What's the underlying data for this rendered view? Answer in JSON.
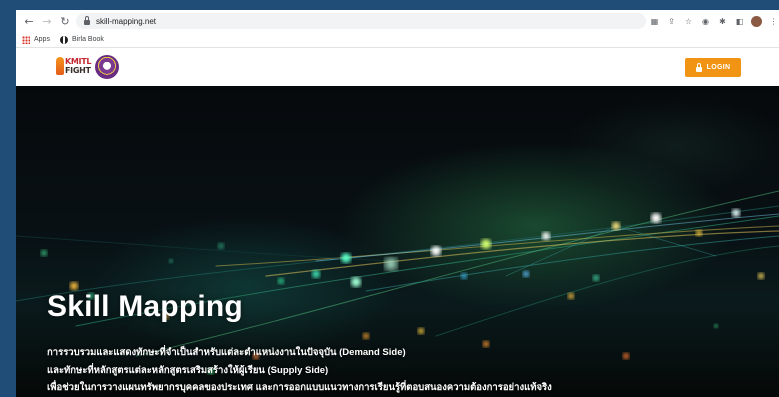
{
  "browser": {
    "url": "skill-mapping.net",
    "bookmarks": [
      {
        "label": "Apps",
        "icon": "apps-grid-icon"
      },
      {
        "label": "Birla Book",
        "icon": "globe-icon"
      }
    ]
  },
  "site": {
    "logo_text_line1": "KMITL",
    "logo_text_line2": "FIGHT",
    "login_label": "LOGIN",
    "accent_color": "#f29413"
  },
  "hero": {
    "title": "Skill Mapping",
    "lines": [
      "การรวบรวมและแสดงทักษะที่จำเป็นสำหรับแต่ละตำแหน่งงานในปัจจุบัน (Demand Side)",
      "และทักษะที่หลักสูตรแต่ละหลักสูตรเสริมสร้างให้ผู้เรียน (Supply Side)",
      "เพื่อช่วยในการวางแผนทรัพยากรบุคคลของประเทศ และการออกแบบแนวทางการเรียนรู้ที่ตอบสนองความต้องการอย่างแท้จริง"
    ]
  }
}
